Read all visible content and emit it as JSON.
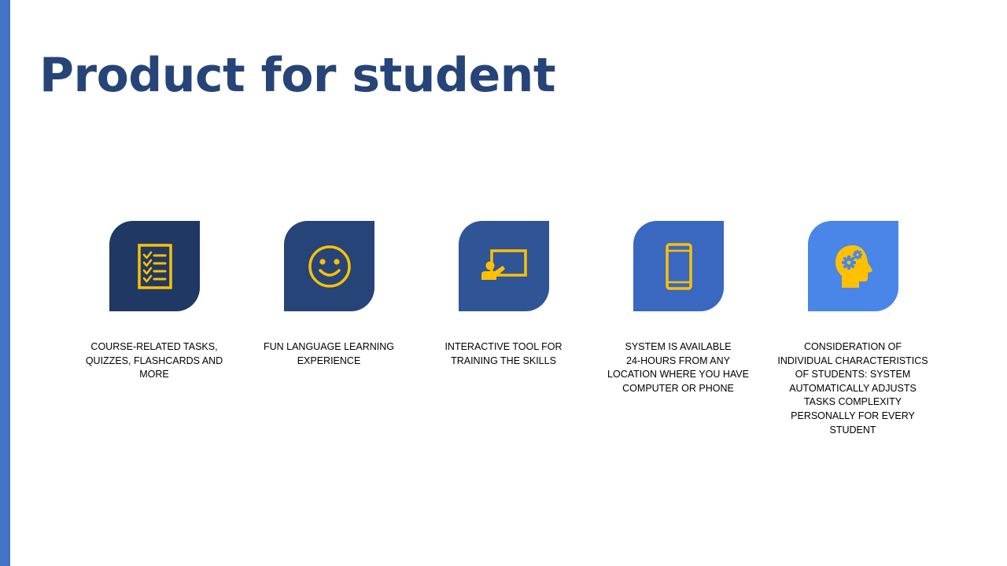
{
  "slide": {
    "title": "Product for student",
    "colors": {
      "accent_bar": "#4472c4",
      "title": "#264478",
      "icon": "#ffc000"
    }
  },
  "features": [
    {
      "icon": "checklist-icon",
      "tile_color": "#1f3864",
      "caption": "COURSE-RELATED TASKS,\nQUIZZES, FLASHCARDS AND\nMORE"
    },
    {
      "icon": "smiley-face-icon",
      "tile_color": "#264478",
      "caption": "FUN LANGUAGE LEARNING\nEXPERIENCE"
    },
    {
      "icon": "presentation-board-icon",
      "tile_color": "#2f5597",
      "caption": "INTERACTIVE TOOL FOR\nTRAINING THE SKILLS"
    },
    {
      "icon": "smartphone-icon",
      "tile_color": "#3a67c0",
      "caption": "SYSTEM IS AVAILABLE\n24-HOURS FROM ANY\nLOCATION WHERE YOU HAVE\nCOMPUTER OR PHONE"
    },
    {
      "icon": "head-gears-icon",
      "tile_color": "#4a86e8",
      "caption": "CONSIDERATION OF\nINDIVIDUAL CHARACTERISTICS\nOF STUDENTS: SYSTEM\nAUTOMATICALLY ADJUSTS\nTASKS COMPLEXITY\nPERSONALLY FOR EVERY\nSTUDENT"
    }
  ]
}
